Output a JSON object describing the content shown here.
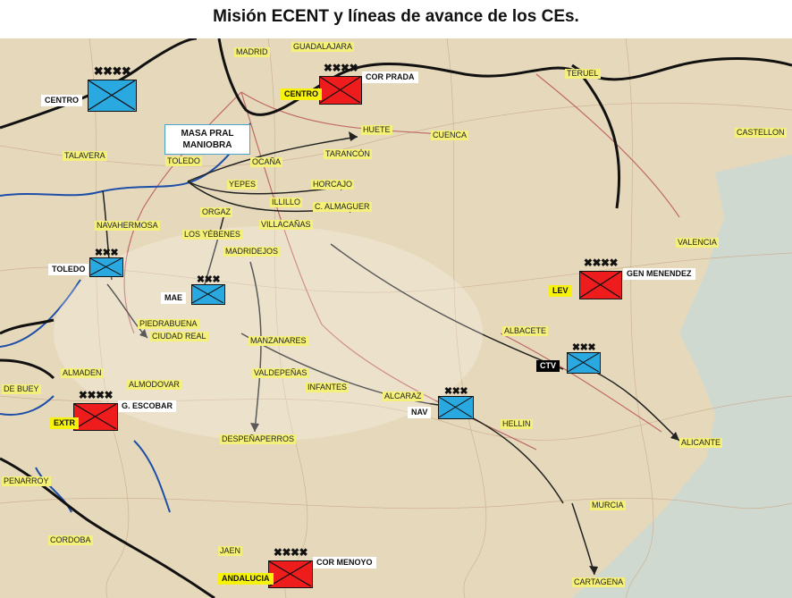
{
  "title": "Misión ECENT y líneas de avance de los CEs.",
  "colors": {
    "map_background": "#e8dcc0",
    "republican_unit": "#2aa8e0",
    "nationalist_unit": "#ee1c1c",
    "front_line": "#111111",
    "rivers": "#1d4ea8",
    "highlight_label": "#f7f20a"
  },
  "map_labels": {
    "madrid": "MADRID",
    "guadalajara": "GUADALAJARA",
    "teruel": "TERUEL",
    "castellon": "CASTELLON",
    "talavera": "TALAVERA",
    "toledo": "TOLEDO",
    "ocana": "OCAÑA",
    "huete": "HUETE",
    "cuenca": "CUENCA",
    "tarancon": "TARANCÓN",
    "horcajo": "HORCAJO",
    "yepes": "YEPES",
    "illillo": "ILLILLO",
    "almaguer": "C. ALMAGUER",
    "orgaz": "ORGAZ",
    "yebenes": "LOS YÉBENES",
    "villacanas": "VILLACAÑAS",
    "madridejos": "MADRIDEJOS",
    "navahermosa": "NAVAHERMOSA",
    "valencia": "VALENCIA",
    "piedrabuena": "PIEDRABUENA",
    "ciudad_real": "CIUDAD REAL",
    "manzanares": "MANZANARES",
    "valdepenas": "VALDEPEÑAS",
    "albacete": "ALBACETE",
    "almaden": "ALMADEN",
    "almodovar": "ALMODOVAR",
    "infantes": "INFANTES",
    "alcaraz": "ALCARAZ",
    "hellin": "HELLIN",
    "alicante": "ALICANTE",
    "despenaperros": "DESPEÑAPERROS",
    "murcia": "MURCIA",
    "cordoba": "CORDOBA",
    "jaen": "JAEN",
    "cartagena": "CARTAGENA",
    "benalcazar": "DE BUEY",
    "penarroya": "PENARROY"
  },
  "callout": {
    "line1": "MASA PRAL",
    "line2": "MANIOBRA"
  },
  "units": [
    {
      "id": "centro-rep",
      "side": "republican",
      "echelon": "XXXX",
      "label": "CENTRO",
      "label_style": "white",
      "extra": ""
    },
    {
      "id": "centro-nat",
      "side": "nationalist",
      "echelon": "XXXX",
      "label": "CENTRO",
      "label_style": "yellow",
      "extra": "COR PRADA"
    },
    {
      "id": "toledo",
      "side": "republican",
      "echelon": "XXX",
      "label": "TOLEDO",
      "label_style": "white",
      "extra": ""
    },
    {
      "id": "mae",
      "side": "republican",
      "echelon": "XXX",
      "label": "MAE",
      "label_style": "white",
      "extra": ""
    },
    {
      "id": "lev",
      "side": "nationalist",
      "echelon": "XXXX",
      "label": "LEV",
      "label_style": "yellow",
      "extra": "GEN MENENDEZ"
    },
    {
      "id": "ctv",
      "side": "republican",
      "echelon": "XXX",
      "label": "CTV",
      "label_style": "black",
      "extra": ""
    },
    {
      "id": "extr",
      "side": "nationalist",
      "echelon": "XXXX",
      "label": "EXTR",
      "label_style": "yellow",
      "extra": "G. ESCOBAR"
    },
    {
      "id": "nav",
      "side": "republican",
      "echelon": "XXX",
      "label": "NAV",
      "label_style": "white",
      "extra": ""
    },
    {
      "id": "andalucia",
      "side": "nationalist",
      "echelon": "XXXX",
      "label": "ANDALUCIA",
      "label_style": "yellow",
      "extra": "COR MENOYO"
    }
  ],
  "echelon_glyphs": {
    "army": "✖✖✖✖",
    "corps": "✖✖✖"
  }
}
